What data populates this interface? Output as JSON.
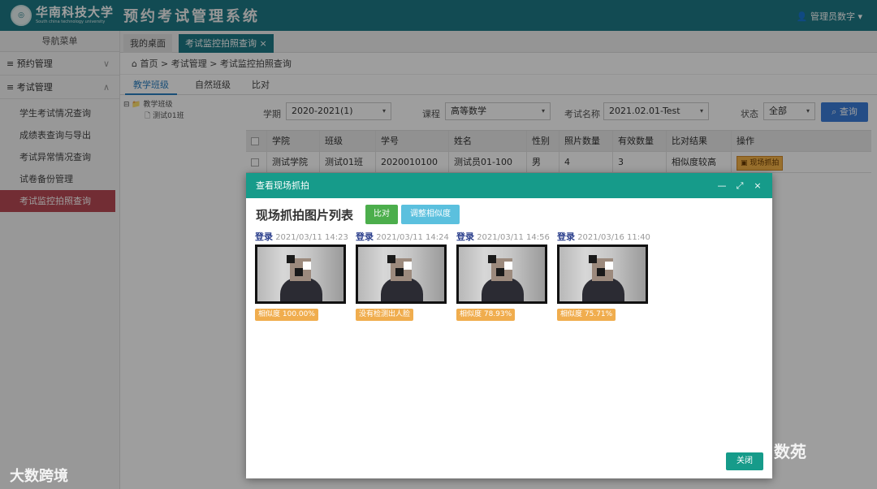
{
  "header": {
    "logo_cn": "华南科技大学",
    "logo_en": "South china technology university",
    "system_title": "预约考试管理系统",
    "user_label": "管理员数字",
    "user_caret": "▾",
    "user_icon": "user-icon"
  },
  "sidebar": {
    "title": "导航菜单",
    "groups": [
      {
        "label": "预约管理",
        "chevron": "∨"
      },
      {
        "label": "考试管理",
        "chevron": "∧"
      }
    ],
    "items": [
      {
        "label": "学生考试情况查询"
      },
      {
        "label": "成绩表查询与导出"
      },
      {
        "label": "考试异常情况查询"
      },
      {
        "label": "试卷备份管理"
      },
      {
        "label": "考试监控拍照查询"
      }
    ],
    "menu_glyph": "≡",
    "toggle_glyph": "◀"
  },
  "tabs": {
    "home": "我的桌面",
    "current": "考试监控拍照查询",
    "close_glyph": "×"
  },
  "breadcrumb": {
    "text": "首页 > 考试管理 > 考试监控拍照查询",
    "home_glyph": "⌂"
  },
  "subtabs": [
    {
      "label": "教学班级"
    },
    {
      "label": "自然班级"
    },
    {
      "label": "比对"
    }
  ],
  "tree": {
    "root": "教学班级",
    "child": "测试01班",
    "expand_glyph": "⊟"
  },
  "filters": {
    "term_label": "学期",
    "term_value": "2020-2021(1)",
    "course_label": "课程",
    "course_value": "高等数学",
    "exam_label": "考试名称",
    "exam_value": "2021.02.01-Test",
    "status_label": "状态",
    "status_value": "全部",
    "query_label": "查询",
    "arrow_glyph": "▾"
  },
  "table": {
    "headers": [
      "学院",
      "班级",
      "学号",
      "姓名",
      "性别",
      "照片数量",
      "有效数量",
      "比对结果",
      "操作"
    ],
    "rows": [
      {
        "college": "测试学院",
        "class": "测试01班",
        "student_no": "2020010100",
        "name": "测试员01-100",
        "gender": "男",
        "photo_count": "4",
        "valid_count": "3",
        "result": "相似度较高",
        "action": "现场抓拍"
      }
    ]
  },
  "modal": {
    "title": "查看现场抓拍",
    "ctrl_min": "—",
    "ctrl_max": "⤢",
    "ctrl_close": "×",
    "list_title": "现场抓拍图片列表",
    "compare_label": "比对",
    "adjust_label": "调整相似度",
    "close_label": "关闭",
    "photos": [
      {
        "kind": "登录",
        "time": "2021/03/11 14:23",
        "similarity": "相似度 100.00%"
      },
      {
        "kind": "登录",
        "time": "2021/03/11 14:24",
        "similarity": "没有检测出人脸"
      },
      {
        "kind": "登录",
        "time": "2021/03/11 14:56",
        "similarity": "相似度 78.93%"
      },
      {
        "kind": "登录",
        "time": "2021/03/16 11:40",
        "similarity": "相似度 75.71%"
      }
    ]
  },
  "watermarks": {
    "left": "大数跨境",
    "right": "数苑"
  }
}
